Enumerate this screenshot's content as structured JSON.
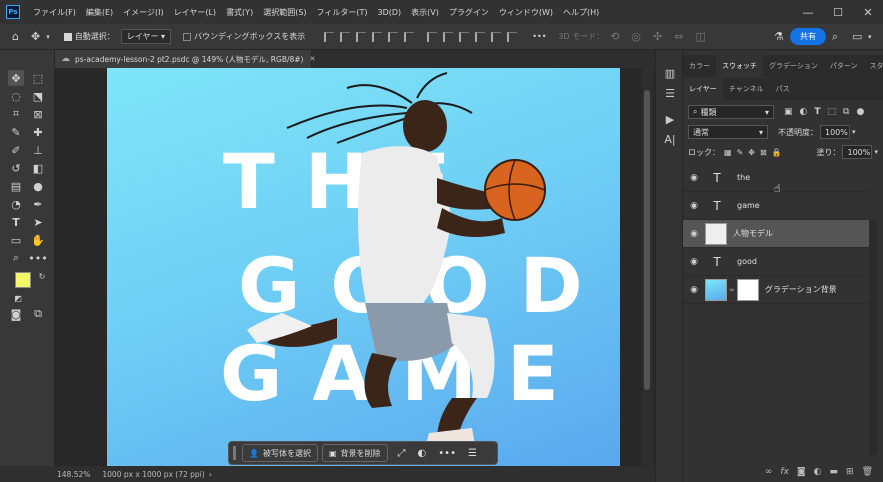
{
  "menubar": {
    "logo": "Ps",
    "items": [
      "ファイル(F)",
      "編集(E)",
      "イメージ(I)",
      "レイヤー(L)",
      "書式(Y)",
      "選択範囲(S)",
      "フィルター(T)",
      "3D(D)",
      "表示(V)",
      "プラグイン",
      "ウィンドウ(W)",
      "ヘルプ(H)"
    ],
    "minimize": "—",
    "maximize": "☐",
    "close": "✕"
  },
  "options": {
    "auto_select_label": "自動選択：",
    "auto_select_value": "レイヤー",
    "bounding_box_label": "バウンディングボックスを表示",
    "more": "•••",
    "mode_3d": "3D モード：",
    "share": "共有"
  },
  "document": {
    "tab_title": "ps-academy-lesson-2 pt2.psdc @ 149% (人物モデル, RGB/8#)",
    "tab_close": "✕",
    "art_lines": [
      "THE",
      "GOOD",
      "GAME"
    ]
  },
  "context_bar": {
    "select_subject": "被写体を選択",
    "remove_background": "背景を削除",
    "more": "•••"
  },
  "status": {
    "zoom": "148.52%",
    "doc_size": "1000 px x 1000 px (72 ppi)"
  },
  "panels": {
    "top_tabs": [
      "カラー",
      "スウォッチ",
      "グラデーション",
      "パターン",
      "スタイル"
    ],
    "top_active": 1,
    "layer_tabs": [
      "レイヤー",
      "チャンネル",
      "パス"
    ],
    "layer_active": 0,
    "filter_kind": "種類",
    "blend_mode": "通常",
    "opacity_label": "不透明度：",
    "opacity_value": "100%",
    "lock_label": "ロック：",
    "fill_label": "塗り：",
    "fill_value": "100%",
    "layers": [
      {
        "name": "the",
        "type": "text",
        "selected": false
      },
      {
        "name": "game",
        "type": "text",
        "selected": false
      },
      {
        "name": "人物モデル",
        "type": "image",
        "selected": true
      },
      {
        "name": "good",
        "type": "text",
        "selected": false
      },
      {
        "name": "グラデーション背景",
        "type": "gradient",
        "selected": false
      }
    ]
  },
  "colors": {
    "foreground": "#f5f56a",
    "background": "#ffffff",
    "accent": "#1473e6"
  }
}
